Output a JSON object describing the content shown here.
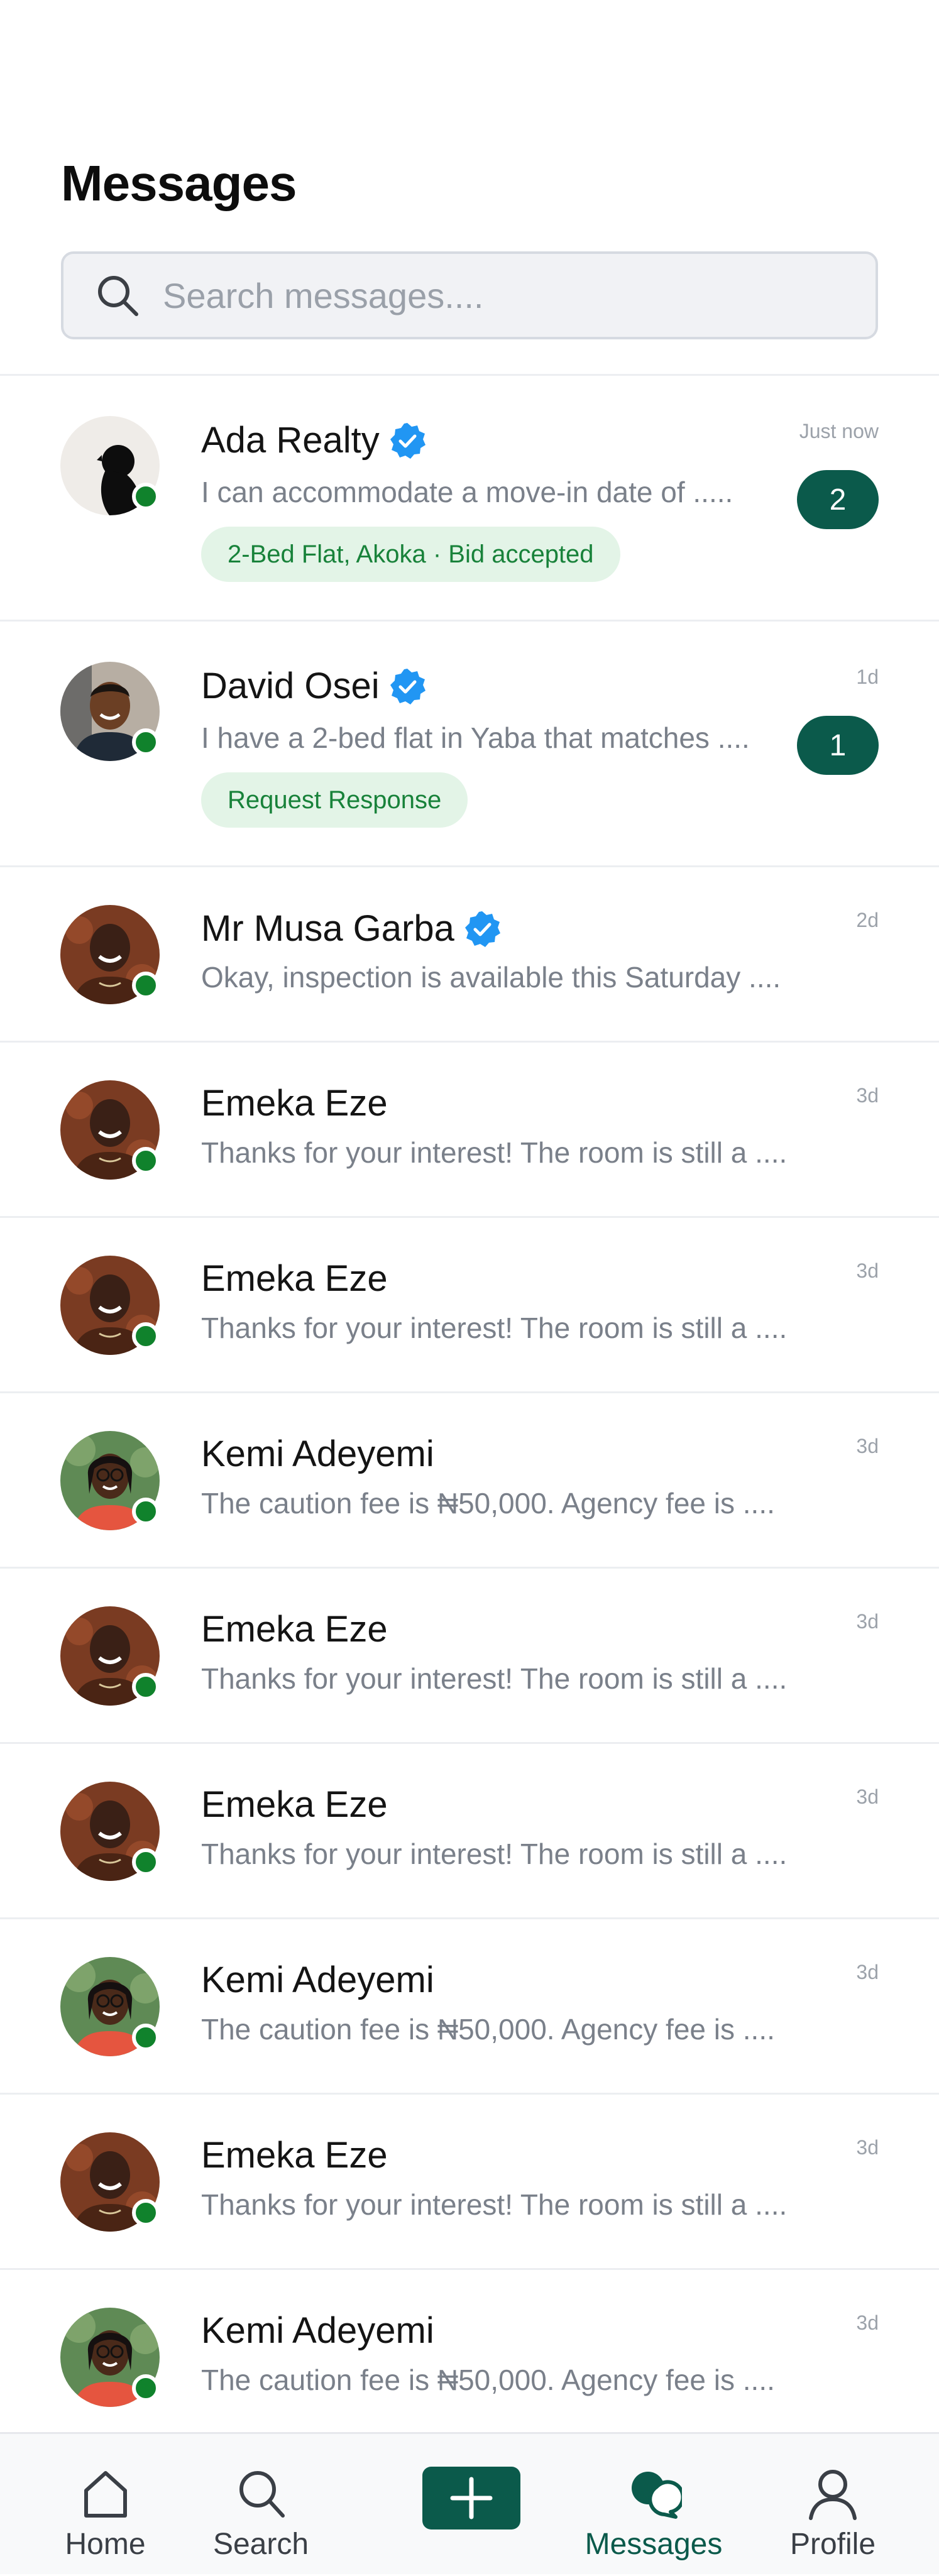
{
  "page": {
    "title": "Messages"
  },
  "search": {
    "placeholder": "Search messages...."
  },
  "conversations": [
    {
      "name": "Ada Realty",
      "verified": true,
      "preview": "I can accommodate a move-in date of .....",
      "time": "Just now",
      "unread": "2",
      "tag": "2-Bed Flat, Akoka · Bid accepted",
      "avatar": "silhouette"
    },
    {
      "name": "David Osei",
      "verified": true,
      "preview": "I have a 2-bed flat in Yaba that matches ....",
      "time": "1d",
      "unread": "1",
      "tag": "Request Response",
      "avatar": "man-smiling"
    },
    {
      "name": "Mr Musa Garba",
      "verified": true,
      "preview": "Okay, inspection is available this Saturday ....",
      "time": "2d",
      "avatar": "man-brown-bg"
    },
    {
      "name": "Emeka Eze",
      "verified": false,
      "preview": "Thanks for your interest! The room is still a ....",
      "time": "3d",
      "avatar": "man-brown-bg"
    },
    {
      "name": "Emeka Eze",
      "verified": false,
      "preview": "Thanks for your interest! The room is still a ....",
      "time": "3d",
      "avatar": "man-brown-bg"
    },
    {
      "name": "Kemi Adeyemi",
      "verified": false,
      "preview": "The caution fee is ₦50,000. Agency fee is ....",
      "time": "3d",
      "avatar": "woman-glasses"
    },
    {
      "name": "Emeka Eze",
      "verified": false,
      "preview": "Thanks for your interest! The room is still a ....",
      "time": "3d",
      "avatar": "man-brown-bg"
    },
    {
      "name": "Emeka Eze",
      "verified": false,
      "preview": "Thanks for your interest! The room is still a ....",
      "time": "3d",
      "avatar": "man-brown-bg"
    },
    {
      "name": "Kemi Adeyemi",
      "verified": false,
      "preview": "The caution fee is ₦50,000. Agency fee is ....",
      "time": "3d",
      "avatar": "woman-glasses"
    },
    {
      "name": "Emeka Eze",
      "verified": false,
      "preview": "Thanks for your interest! The room is still a ....",
      "time": "3d",
      "avatar": "man-brown-bg"
    },
    {
      "name": "Kemi Adeyemi",
      "verified": false,
      "preview": "The caution fee is ₦50,000. Agency fee is ....",
      "time": "3d",
      "avatar": "woman-glasses"
    }
  ],
  "nav": {
    "home": "Home",
    "search": "Search",
    "add_icon": "plus-icon",
    "messages": "Messages",
    "profile": "Profile",
    "active": "messages"
  },
  "colors": {
    "brand": "#0b5a4b",
    "online": "#10822c",
    "verified": "#2196f3",
    "chip_bg": "#e3f4e7",
    "chip_text": "#18823a"
  }
}
